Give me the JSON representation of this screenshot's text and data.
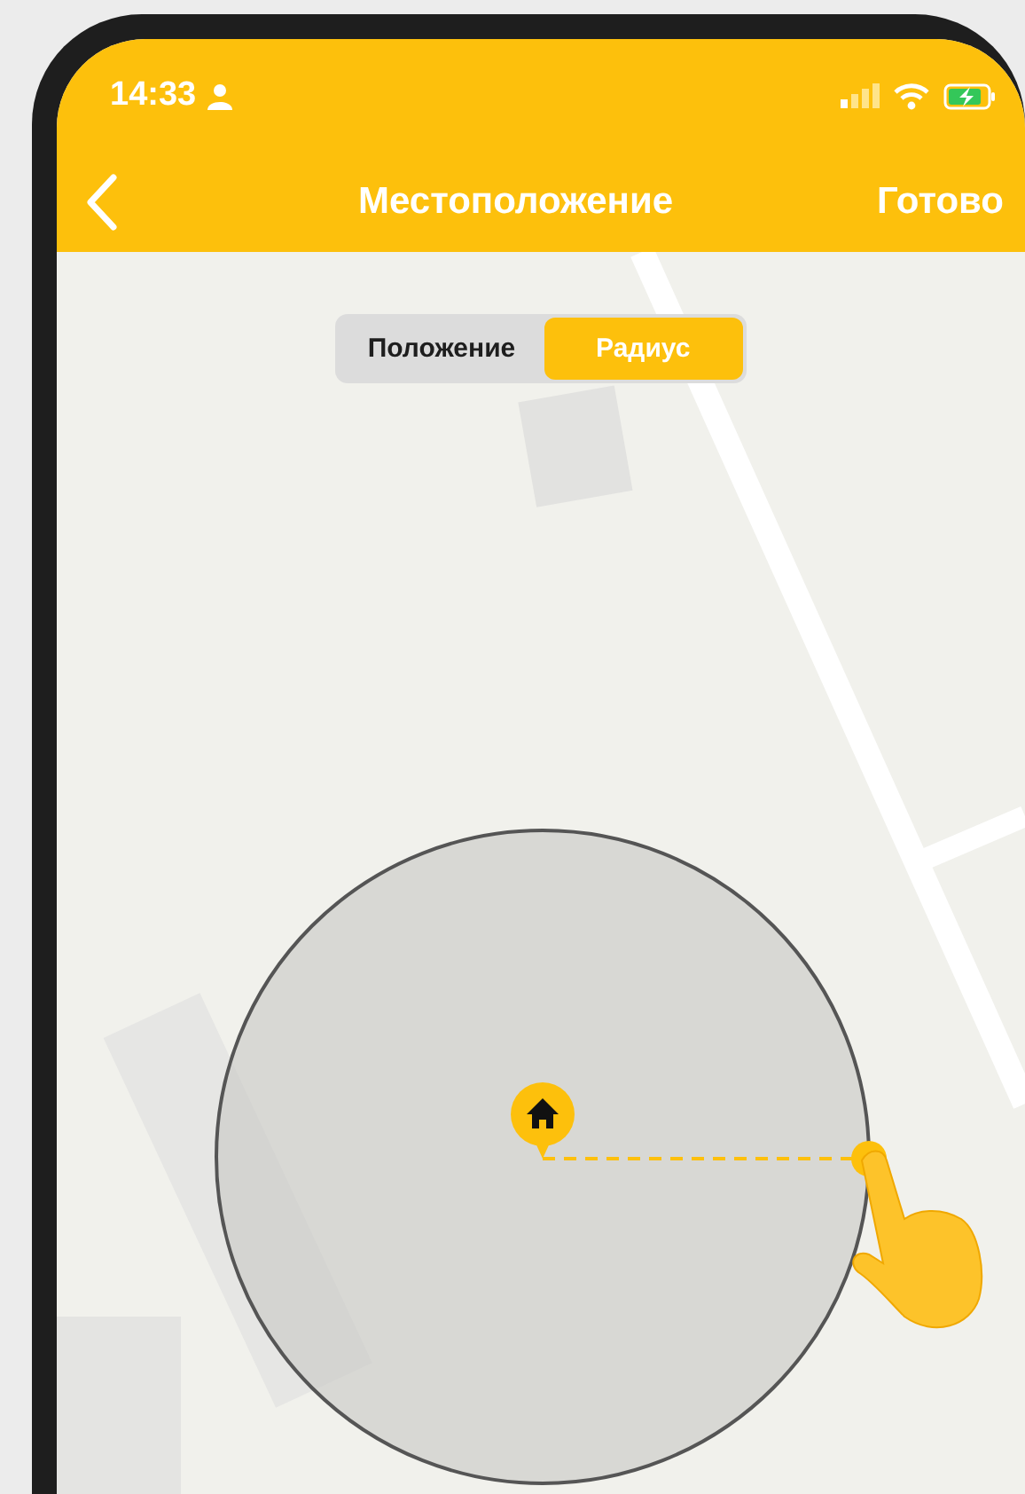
{
  "status_bar": {
    "time": "14:33"
  },
  "nav_bar": {
    "title": "Местоположение",
    "action": "Готово"
  },
  "segments": [
    {
      "label": "Положение",
      "selected": false
    },
    {
      "label": "Радиус",
      "selected": true
    }
  ]
}
